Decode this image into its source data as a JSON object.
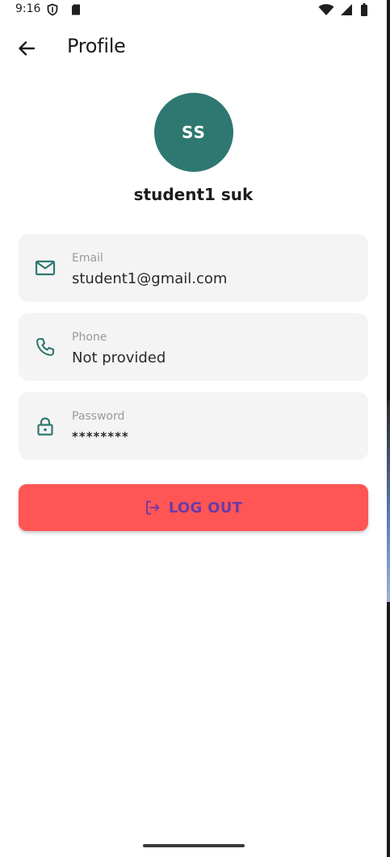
{
  "status_bar": {
    "time": "9:16",
    "left_icons": [
      "shield-icon",
      "sd-card-icon"
    ],
    "right_icons": [
      "wifi-icon",
      "cell-signal-icon",
      "battery-icon"
    ]
  },
  "app_bar": {
    "title": "Profile",
    "back_icon": "arrow-left-icon"
  },
  "profile": {
    "initials": "SS",
    "name": "student1 suk",
    "avatar_color": "#2e7871"
  },
  "fields": {
    "email": {
      "label": "Email",
      "value": "student1@gmail.com",
      "icon": "mail-icon"
    },
    "phone": {
      "label": "Phone",
      "value": "Not provided",
      "icon": "phone-icon"
    },
    "password": {
      "label": "Password",
      "value": "********",
      "icon": "lock-icon"
    }
  },
  "logout": {
    "label": "LOG OUT",
    "icon": "logout-icon",
    "background": "#ff5555",
    "text_color": "#6a3aa8"
  },
  "colors": {
    "accent": "#2e7871",
    "card_background": "#f4f4f4"
  }
}
